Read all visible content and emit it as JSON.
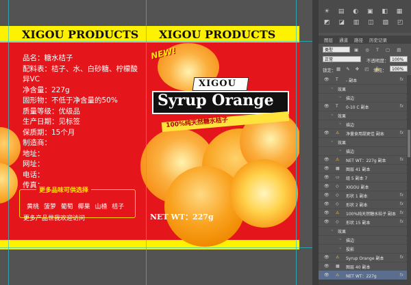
{
  "label": {
    "band_title_left": "XIGOU PRODUCTS",
    "band_title_right": "XIGOU PRODUCTS",
    "info": [
      "品名：糖水桔子",
      "配料表：桔子、水、白砂糖、柠檬酸",
      "异VC",
      "净含量：227g",
      "固形物：不低于净含量的50%",
      "质量等级：优级品",
      "生产日期：见标签",
      "保质期：15个月",
      "制造商：",
      "地址：",
      "网址：",
      "电话：",
      "传真："
    ],
    "more_title": "更多品味可供选择",
    "more_items": "黄桃 菠萝 葡萄 椰果 山楂 桔子",
    "more_foot": "更多产品世我欢迎访问",
    "new_badge": "NEW!",
    "brand": "XIGOU",
    "product_name": "Syrup Orange",
    "tagline": "100%纯天然糖水桔子",
    "net_weight": "NET WT：227g",
    "colors": {
      "label_red": "#e4161b",
      "band_yellow": "#fff200",
      "orange": "#f7941d"
    }
  },
  "panel": {
    "tabs": [
      "图层",
      "通道",
      "路径",
      "历史记录"
    ],
    "kind_label": "类型",
    "blend_mode": "正常",
    "opacity_label": "不透明度：",
    "opacity_value": "100%",
    "lock_label": "锁定：",
    "fill_label": "填充：",
    "fill_value": "100%",
    "layers": [
      {
        "name": "- 副本",
        "type": "text",
        "fx": true,
        "selected": false
      },
      {
        "name": "效果",
        "type": "effect",
        "fx": false,
        "selected": false
      },
      {
        "name": "描边",
        "type": "effect-item",
        "fx": false,
        "selected": false
      },
      {
        "name": "0-10 C 副本",
        "type": "text",
        "fx": true,
        "selected": false
      },
      {
        "name": "效果",
        "type": "effect",
        "fx": false,
        "selected": false
      },
      {
        "name": "描边",
        "type": "effect-item",
        "fx": false,
        "selected": false
      },
      {
        "name": "净量食用甜更佳 副本",
        "type": "warn",
        "fx": true,
        "selected": false
      },
      {
        "name": "效果",
        "type": "effect",
        "fx": false,
        "selected": false
      },
      {
        "name": "描边",
        "type": "effect-item",
        "fx": false,
        "selected": false
      },
      {
        "name": "NET WT：227g 副本",
        "type": "warn",
        "fx": true,
        "selected": false
      },
      {
        "name": "图层 41 副本",
        "type": "image",
        "fx": false,
        "selected": false
      },
      {
        "name": "组 5 副本 7",
        "type": "group",
        "fx": false,
        "selected": false
      },
      {
        "name": "XIGOU 副本",
        "type": "shape",
        "fx": false,
        "selected": false
      },
      {
        "name": "形状 1 副本",
        "type": "shape",
        "fx": true,
        "selected": false
      },
      {
        "name": "形状 2 副本",
        "type": "shape",
        "fx": true,
        "selected": false
      },
      {
        "name": "100%纯天然糖水桔子 副本",
        "type": "warn",
        "fx": true,
        "selected": false
      },
      {
        "name": "形状 15 副本",
        "type": "shape",
        "fx": true,
        "selected": false
      },
      {
        "name": "效果",
        "type": "effect",
        "fx": false,
        "selected": false
      },
      {
        "name": "描边",
        "type": "effect-item",
        "fx": false,
        "selected": false
      },
      {
        "name": "投影",
        "type": "effect-item",
        "fx": false,
        "selected": false
      },
      {
        "name": "Syrup Orange 副本",
        "type": "warn",
        "fx": true,
        "selected": false
      },
      {
        "name": "图层 40 副本",
        "type": "image",
        "fx": false,
        "selected": false
      },
      {
        "name": "NET WT：227g",
        "type": "warn",
        "fx": true,
        "selected": true
      }
    ]
  }
}
